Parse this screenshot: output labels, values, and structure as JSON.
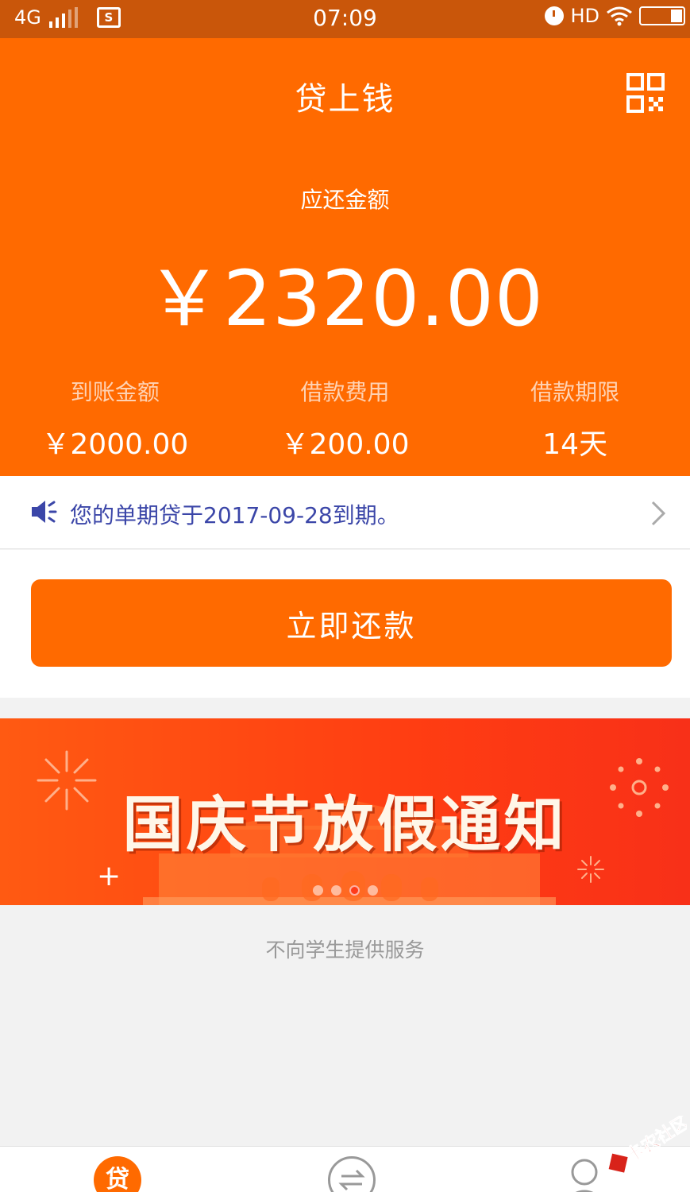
{
  "status_bar": {
    "network": "4G",
    "time": "07:09",
    "hd": "HD"
  },
  "header": {
    "app_title": "贷上钱",
    "due_label": "应还金额",
    "due_amount": "￥2320.00",
    "stats": [
      {
        "label": "到账金额",
        "value": "￥2000.00"
      },
      {
        "label": "借款费用",
        "value": "￥200.00"
      },
      {
        "label": "借款期限",
        "value": "14天"
      }
    ]
  },
  "notice": {
    "text": "您的单期贷于2017-09-28到期。"
  },
  "repay_button": {
    "label": "立即还款"
  },
  "banner": {
    "text": "国庆节放假通知",
    "slide_count": 4,
    "active_slide": 3
  },
  "footer_note": "不向学生提供服务",
  "tabbar": {
    "loan_icon_text": "贷"
  },
  "watermark": {
    "text": "卡农社区"
  },
  "colors": {
    "brand_orange": "#ff6a00",
    "status_bar": "#c9560a",
    "notice_text": "#3b46a8",
    "background": "#f2f2f2"
  },
  "icons": [
    "signal-icon",
    "screenshot-icon",
    "alarm-icon",
    "wifi-icon",
    "battery-icon",
    "qr-code-icon",
    "speaker-icon",
    "chevron-right-icon",
    "exchange-icon",
    "user-icon"
  ]
}
